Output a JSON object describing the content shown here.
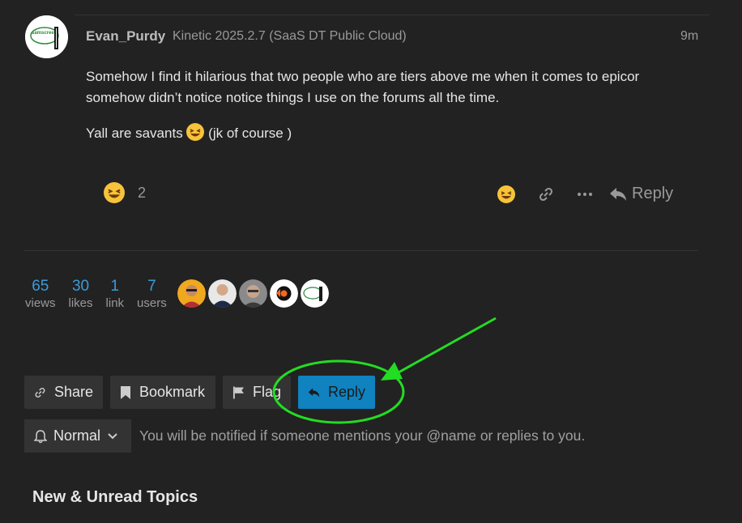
{
  "post": {
    "username": "Evan_Purdy",
    "user_title": "Kinetic 2025.2.7 (SaaS DT Public Cloud)",
    "time": "9m",
    "body_line1": "Somehow I find it hilarious that two people who are tiers above me when it comes to epicor somehow didn’t notice notice things I use on the forums all the time.",
    "body_line2_pre": "Yall are savants",
    "body_line2_post": "(jk of course )",
    "avatar_text": "samscreen"
  },
  "reaction": {
    "emoji": "laughing-face",
    "count": "2"
  },
  "post_actions": {
    "reply_label": "Reply"
  },
  "stats": [
    {
      "num": "65",
      "label": "views"
    },
    {
      "num": "30",
      "label": "likes"
    },
    {
      "num": "1",
      "label": "link"
    },
    {
      "num": "7",
      "label": "users"
    }
  ],
  "buttons": {
    "share": "Share",
    "bookmark": "Bookmark",
    "flag": "Flag",
    "reply": "Reply"
  },
  "notification": {
    "level": "Normal",
    "description": "You will be notified if someone mentions your @name or replies to you."
  },
  "section": {
    "title": "New & Unread Topics"
  },
  "colors": {
    "background": "#222222",
    "accent": "#0f82bf",
    "stat_number": "#3b9bd8",
    "annotation": "#22dd22"
  }
}
